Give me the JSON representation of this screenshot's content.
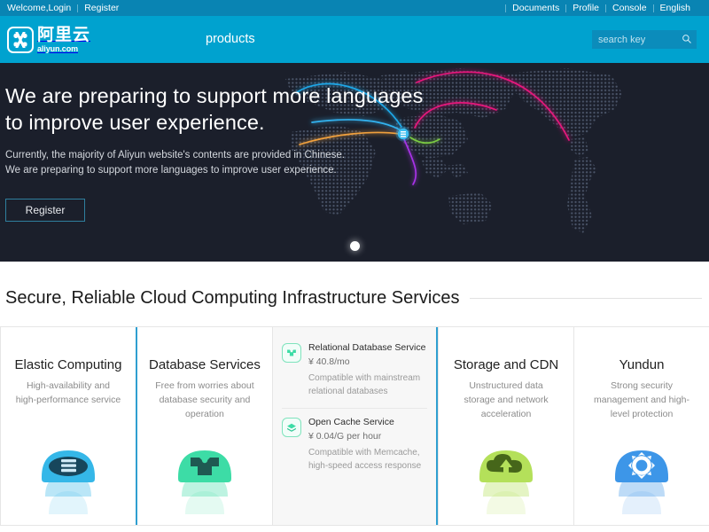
{
  "topbar": {
    "left": [
      {
        "label": "Welcome,Login",
        "name": "welcome-login-link"
      },
      {
        "label": "Register",
        "name": "register-link"
      }
    ],
    "right": [
      {
        "label": "Documents",
        "name": "documents-link"
      },
      {
        "label": "Profile",
        "name": "profile-link"
      },
      {
        "label": "Console",
        "name": "console-link"
      },
      {
        "label": "English",
        "name": "english-link"
      }
    ],
    "bg_color": "#0984b3"
  },
  "nav": {
    "logo_cn": "阿里云",
    "logo_en": "aliyun.com",
    "logo_icon": "aliyun-logo-icon",
    "items": [
      {
        "label": "products",
        "name": "nav-item-products"
      }
    ],
    "bg_color": "#00a2cf"
  },
  "search": {
    "placeholder": "search key",
    "value": "",
    "icon": "search-icon"
  },
  "hero": {
    "title_line1": "We are preparing to support more languages",
    "title_line2": "to improve user experience.",
    "sub_line1": "Currently, the majority of Aliyun website's contents are provided in Chinese.",
    "sub_line2": "We are preparing to support more languages to improve user experience.",
    "button_label": "Register",
    "bg_color": "#1b1f2b",
    "carousel": {
      "slides": 1,
      "active": 1
    },
    "map_arcs": [
      {
        "color": "#1fa8e8",
        "name": "arc-blue-north"
      },
      {
        "color": "#33b3f0",
        "name": "arc-blue-west"
      },
      {
        "color": "#f0a03c",
        "name": "arc-orange-west"
      },
      {
        "color": "#e8187c",
        "name": "arc-pink-northeast"
      },
      {
        "color": "#e8187c",
        "name": "arc-pink-east"
      },
      {
        "color": "#7ac943",
        "name": "arc-green-short"
      },
      {
        "color": "#a832e8",
        "name": "arc-purple-south"
      }
    ],
    "hub_icon": "server-hub-icon"
  },
  "section": {
    "title": "Secure, Reliable Cloud Computing Infrastructure Services"
  },
  "cards": [
    {
      "name": "card-elastic-computing",
      "title": "Elastic Computing",
      "desc": "High-availability and high-performance service",
      "icon": "cloud-server-icon",
      "color": "#35b7e8",
      "glyph_color": "#17465c"
    },
    {
      "name": "card-database-services",
      "title": "Database Services",
      "desc": "Free from worries about database security and operation",
      "icon": "database-icon",
      "color": "#3ddca6",
      "glyph_color": "#1f5a52"
    },
    {
      "name": "card-storage-cdn",
      "title": "Storage and CDN",
      "desc": "Unstructured data storage and network acceleration",
      "icon": "cloud-upload-icon",
      "color": "#b4e05a",
      "glyph_color": "#46661a"
    },
    {
      "name": "card-yundun",
      "title": "Yundun",
      "desc": "Strong security management and high-level protection",
      "icon": "security-shield-icon",
      "color": "#3d96e8",
      "glyph_color": "#ffffff"
    }
  ],
  "panel": {
    "accent_color": "#2f9fd0",
    "items": [
      {
        "name": "panel-item-rds",
        "title": "Relational Database Service",
        "price": "¥ 40.8/mo",
        "price_amount": "¥ 40.8",
        "price_unit": "/mo",
        "note": "Compatible with mainstream relational databases",
        "icon": "rds-database-icon"
      },
      {
        "name": "panel-item-ocs",
        "title": "Open Cache Service",
        "price": "¥ 0.04/G per hour",
        "price_amount": "¥ 0.04/G",
        "price_unit": " per hour",
        "note": "Compatible with Memcache, high-speed access response",
        "icon": "cache-layers-icon"
      }
    ]
  }
}
